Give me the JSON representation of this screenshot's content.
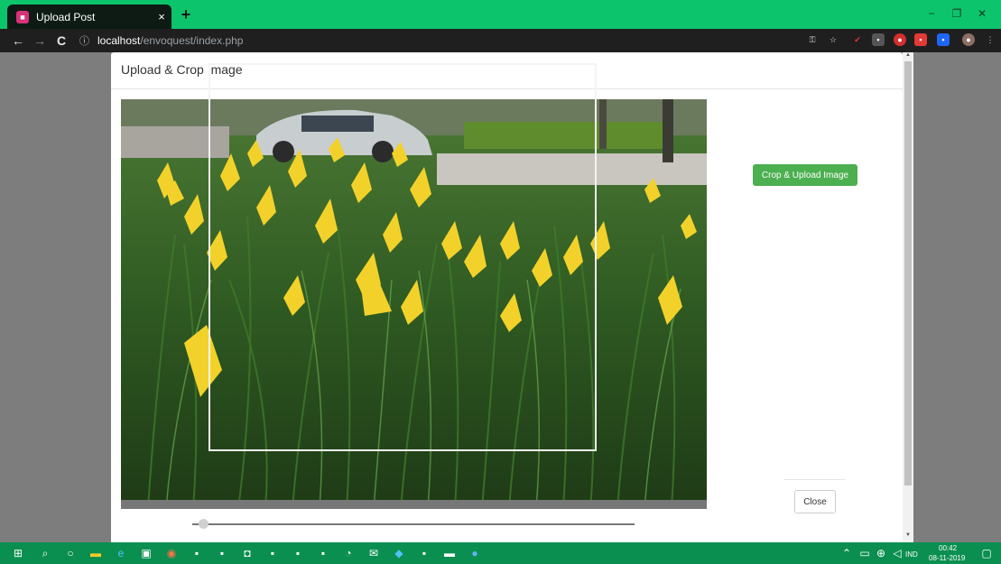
{
  "browser": {
    "tab_title": "Upload Post",
    "tab_close": "×",
    "new_tab": "+",
    "url_info_icon": "ⓘ",
    "url_host": "localhost",
    "url_path": "/envoquest/index.php",
    "window_controls": [
      "−",
      "❐",
      "✕"
    ],
    "nav": {
      "back": "←",
      "forward": "→",
      "reload": "C"
    }
  },
  "modal": {
    "title": "Upload & Crop Image",
    "crop_upload_label": "Crop & Upload Image",
    "close_label": "Close"
  },
  "colors": {
    "tab_strip": "#0cc46c",
    "taskbar": "#0b8f50",
    "primary_button": "#4caf50"
  },
  "taskbar": {
    "tray_lang": "IND",
    "time": "00:42",
    "date": "08-11-2019"
  }
}
